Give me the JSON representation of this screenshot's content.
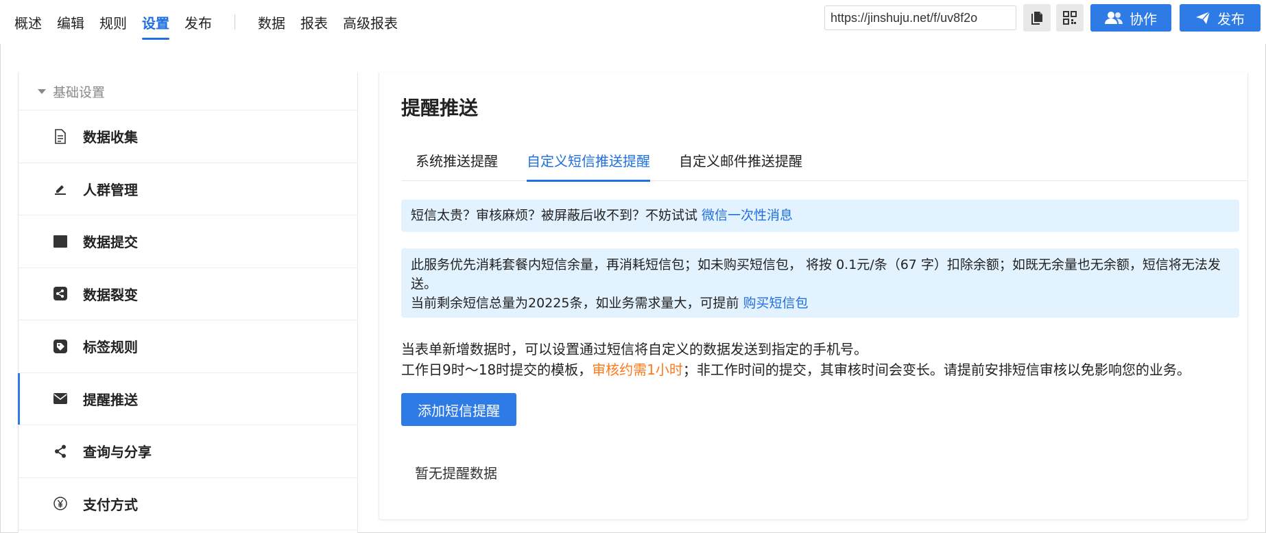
{
  "nav": {
    "items": [
      "概述",
      "编辑",
      "规则",
      "设置",
      "发布"
    ],
    "items2": [
      "数据",
      "报表",
      "高级报表"
    ],
    "active": "设置"
  },
  "toolbar": {
    "url": "https://jinshuju.net/f/uv8f2o",
    "copy_icon": "copy-icon",
    "qr_icon": "qrcode-icon",
    "collab_label": "协作",
    "publish_label": "发布"
  },
  "sidebar": {
    "group_label": "基础设置",
    "items": [
      {
        "label": "数据收集",
        "icon": "document-icon"
      },
      {
        "label": "人群管理",
        "icon": "edit-icon"
      },
      {
        "label": "数据提交",
        "icon": "terminal-icon"
      },
      {
        "label": "数据裂变",
        "icon": "share-square-icon"
      },
      {
        "label": "标签规则",
        "icon": "tag-icon"
      },
      {
        "label": "提醒推送",
        "icon": "mail-icon"
      },
      {
        "label": "查询与分享",
        "icon": "share-icon"
      },
      {
        "label": "支付方式",
        "icon": "yen-icon"
      }
    ],
    "active": "提醒推送"
  },
  "main": {
    "title": "提醒推送",
    "tabs": [
      "系统推送提醒",
      "自定义短信推送提醒",
      "自定义邮件推送提醒"
    ],
    "active_tab": "自定义短信推送提醒",
    "notice1_text": "短信太贵？审核麻烦？被屏蔽后收不到？不妨试试 ",
    "notice1_link": "微信一次性消息",
    "notice2_line1": "此服务优先消耗套餐内短信余量，再消耗短信包；如未购买短信包， 将按 0.1元/条（67 字）扣除余额；如既无余量也无余额，短信将无法发送。",
    "notice2_line2": "当前剩余短信总量为20225条，如业务需求量大，可提前 ",
    "notice2_link": "购买短信包",
    "desc1": "当表单新增数据时，可以设置通过短信将自定义的数据发送到指定的手机号。",
    "desc2_pre": "工作日9时～18时提交的模板，",
    "desc2_highlight": "审核约需1小时",
    "desc2_post": "；非工作时间的提交，其审核时间会变长。请提前安排短信审核以免影响您的业务。",
    "add_button": "添加短信提醒",
    "empty_text": "暂无提醒数据"
  },
  "colors": {
    "accent": "#2f7be6",
    "link": "#1f6fe0",
    "notice_bg": "#e3f2ff",
    "highlight": "#ff7a1a"
  }
}
